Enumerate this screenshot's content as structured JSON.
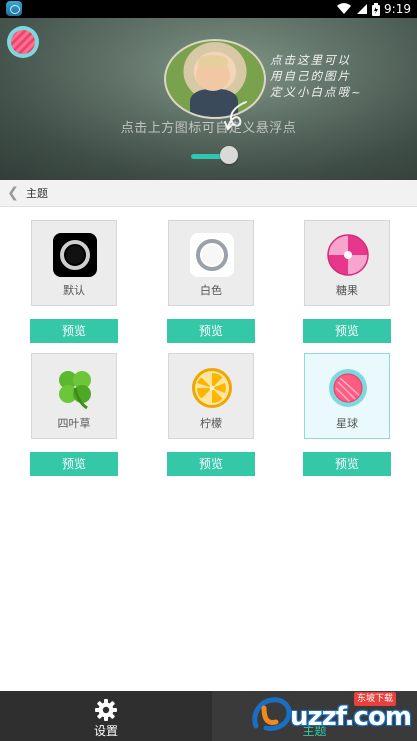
{
  "status_bar": {
    "time": "9:19"
  },
  "header": {
    "hint": [
      "点击这里可以",
      "用自己的图片",
      "定义小白点哦~"
    ],
    "caption": "点击上方图标可自定义悬浮点"
  },
  "title_bar": {
    "title": "主题"
  },
  "themes": [
    {
      "name": "默认",
      "icon": "black-ring-icon"
    },
    {
      "name": "白色",
      "icon": "white-ring-icon"
    },
    {
      "name": "糖果",
      "icon": "candy-icon"
    },
    {
      "name": "四叶草",
      "icon": "clover-icon"
    },
    {
      "name": "柠檬",
      "icon": "lemon-icon"
    },
    {
      "name": "星球",
      "icon": "planet-icon",
      "selected": true
    }
  ],
  "preview_label": "预览",
  "bottom_tabs": [
    {
      "label": "设置",
      "icon": "gear-icon"
    },
    {
      "label": "主题",
      "icon": "theme-icon",
      "active": true
    }
  ],
  "watermark": {
    "text": "uzzf.com",
    "badge": "东坡下载"
  },
  "colors": {
    "accent": "#34c8a9",
    "tab_bg": "#2f2f2f",
    "title_bg": "#f2f2f2"
  }
}
